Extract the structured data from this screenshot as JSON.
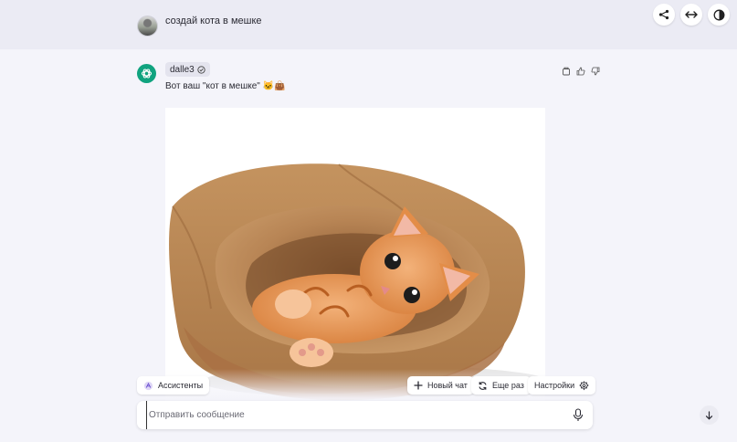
{
  "conversation": {
    "user_message": "создай кота в мешке",
    "bot": {
      "name": "dalle3",
      "text": "Вот ваш \"кот в мешке\" 🐱👜"
    }
  },
  "top_actions": {
    "share": "share-icon",
    "expand": "expand-horizontal-icon",
    "theme": "contrast-icon"
  },
  "chips": {
    "assistants": "Ассистенты",
    "new_chat": "Новый чат",
    "again": "Еще раз",
    "settings": "Настройки"
  },
  "composer": {
    "placeholder": "Отправить сообщение"
  },
  "colors": {
    "brand_green": "#10a37f",
    "page_bg": "#f4f4fa",
    "user_band": "#ebebf4"
  }
}
